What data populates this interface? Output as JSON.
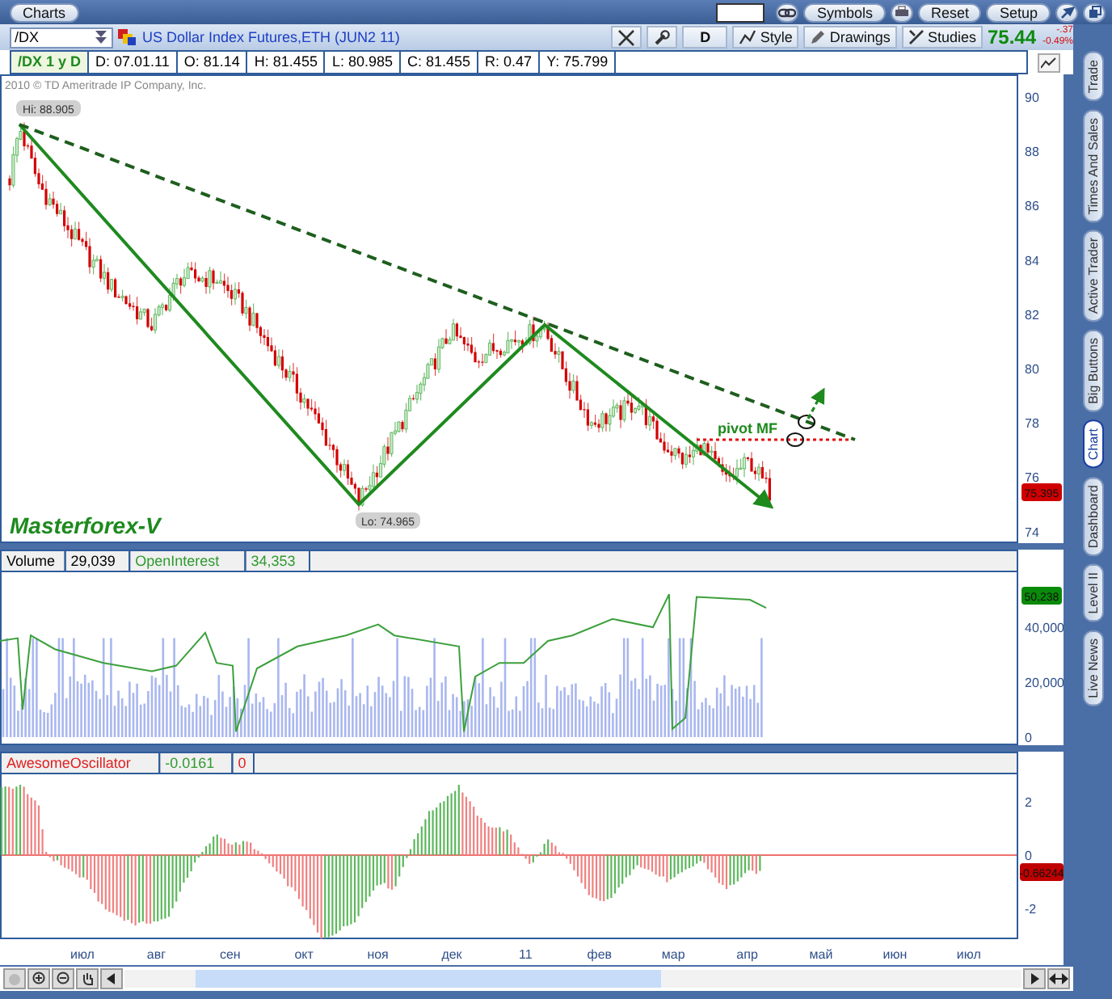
{
  "top_bar": {
    "tab": "Charts",
    "buttons": [
      "Symbols",
      "Reset",
      "Setup"
    ]
  },
  "symbol_bar": {
    "symbol": "/DX",
    "description": "US Dollar Index Futures,ETH (JUN2 11)",
    "aggregation": "D",
    "tools": [
      "Style",
      "Drawings",
      "Studies"
    ],
    "last_price": "75.44",
    "change": "-.37",
    "change_percent": "-0.49%"
  },
  "info_row": [
    {
      "kind": "symbol",
      "text": "/DX 1 y D"
    },
    {
      "kind": "value",
      "text": "D: 07.01.11"
    },
    {
      "kind": "value",
      "text": "O: 81.14"
    },
    {
      "kind": "value",
      "text": "H: 81.455"
    },
    {
      "kind": "value",
      "text": "L: 80.985"
    },
    {
      "kind": "value",
      "text": "C: 81.455"
    },
    {
      "kind": "value",
      "text": "R: 0.47"
    },
    {
      "kind": "value",
      "text": "Y: 75.799"
    }
  ],
  "price_panel": {
    "copyright": "2010 © TD Ameritrade IP Company, Inc.",
    "high_label": "Hi: 88.905",
    "low_label": "Lo: 74.965",
    "caption": "Masterforex-V",
    "pivot_label": "pivot MF",
    "y_ticks": [
      "90",
      "88",
      "86",
      "84",
      "82",
      "80",
      "78",
      "76",
      "74"
    ],
    "last_badge": "75.395"
  },
  "volume_panel": {
    "header": [
      {
        "text": "Volume",
        "color": "#000000"
      },
      {
        "text": "29,039",
        "color": "#000000"
      },
      {
        "text": "OpenInterest",
        "color": "#2e9a2e"
      },
      {
        "text": "34,353",
        "color": "#2e9a2e"
      }
    ],
    "y_ticks": [
      "40,000",
      "20,000",
      "0"
    ],
    "badge": "50,238"
  },
  "oscillator_panel": {
    "header": [
      {
        "text": "AwesomeOscillator",
        "color": "#e02020"
      },
      {
        "text": "-0.0161",
        "color": "#2e9a2e"
      },
      {
        "text": "0",
        "color": "#e02020"
      }
    ],
    "y_ticks": [
      "2",
      "0",
      "-2"
    ],
    "badge": "-0.66244"
  },
  "x_axis": [
    "июл",
    "авг",
    "сен",
    "окт",
    "ноя",
    "дек",
    "11",
    "фев",
    "мар",
    "апр",
    "май",
    "июн",
    "июл"
  ],
  "side_tabs": [
    {
      "label": "Trade",
      "selected": false
    },
    {
      "label": "Times And Sales",
      "selected": false
    },
    {
      "label": "Active Trader",
      "selected": false
    },
    {
      "label": "Big Buttons",
      "selected": false
    },
    {
      "label": "Chart",
      "selected": true
    },
    {
      "label": "Dashboard",
      "selected": false
    },
    {
      "label": "Level II",
      "selected": false
    },
    {
      "label": "Live News",
      "selected": false
    }
  ]
}
